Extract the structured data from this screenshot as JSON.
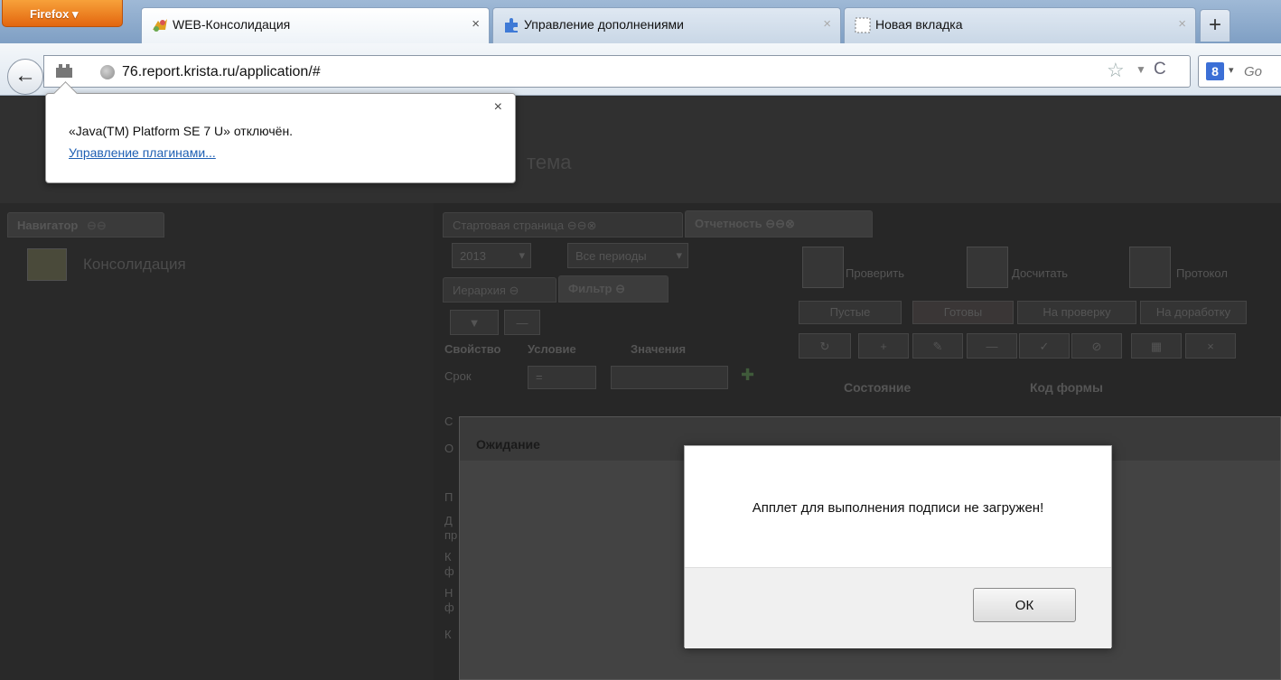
{
  "browser": {
    "menu_label": "Firefox ▾",
    "tabs": [
      {
        "title": "WEB-Консолидация",
        "close": "×"
      },
      {
        "title": "Управление дополнениями",
        "close": "×"
      },
      {
        "title": "Новая вкладка",
        "close": "×"
      }
    ],
    "new_tab": "+",
    "back": "←",
    "url": "76.report.krista.ru/application/#",
    "star": "☆",
    "dropmarker": "▼",
    "reload": "C",
    "search_engine": "8",
    "search_drop": "▾",
    "search_placeholder": "Go"
  },
  "plugin_notification": {
    "close": "×",
    "message": "«Java(TM) Platform SE 7 U» отключён.",
    "link": "Управление плагинами..."
  },
  "app": {
    "title_fragment": "тема",
    "navigator": {
      "tab_label": "Навигатор",
      "tab_icons": "⊖⊖",
      "item": "Консолидация"
    },
    "doc_tabs": [
      {
        "label": "Стартовая страница ⊖⊖⊗"
      },
      {
        "label": "Отчетность ⊖⊖⊗"
      }
    ],
    "filters": {
      "year": "2013",
      "year_arrow": "▾",
      "period": "Все периоды",
      "period_arrow": "▾"
    },
    "subtabs": [
      {
        "label": "Иерархия ⊖"
      },
      {
        "label": "Фильтр ⊖"
      }
    ],
    "filter_buttons": [
      "▼",
      "—"
    ],
    "columns": [
      "Свойство",
      "Условие",
      "Значения"
    ],
    "row_label": "Срок",
    "row_condition": "=",
    "row_add": "✚",
    "row_letters": [
      "С",
      "О",
      "П",
      "Д",
      "пр",
      "К",
      "ф",
      "Н",
      "ф",
      "К"
    ],
    "toolbar": [
      {
        "label": "Проверить"
      },
      {
        "label": "Досчитать"
      },
      {
        "label": "Протокол"
      }
    ],
    "status_filters": [
      "Пустые",
      "Готовы",
      "На проверку",
      "На доработку"
    ],
    "action_icons": [
      "↻",
      "+",
      "✎",
      "—",
      "✓",
      "⊘",
      "▦",
      "×"
    ],
    "grid_columns": [
      "Состояние",
      "Код формы"
    ]
  },
  "wait_window": {
    "title": "Ожидание"
  },
  "alert": {
    "message": "Апплет для выполнения подписи не загружен!",
    "ok_label": "ОК"
  }
}
